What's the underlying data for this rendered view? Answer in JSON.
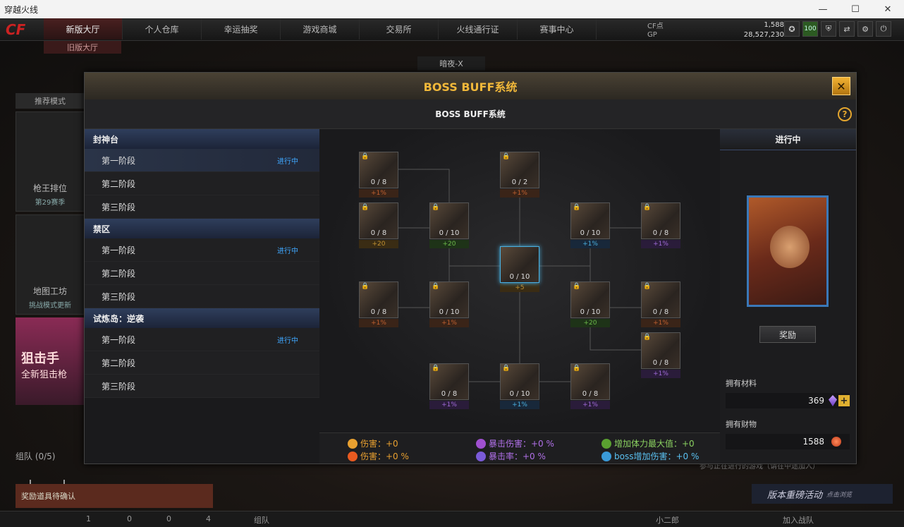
{
  "window": {
    "title": "穿越火线",
    "controls": [
      "—",
      "☐",
      "✕"
    ]
  },
  "topnav": {
    "logo": "CF",
    "tabs": [
      "新版大厅",
      "个人仓库",
      "幸运抽奖",
      "游戏商城",
      "交易所",
      "火线通行证",
      "赛事中心"
    ],
    "old_hall": "旧版大厅",
    "currency": [
      {
        "label": "CF点",
        "value": "1,588"
      },
      {
        "label": "GP",
        "value": "28,527,230"
      }
    ],
    "level_badge": "100"
  },
  "map_name": "暗夜-X",
  "bg_left": {
    "header": "推荐模式",
    "card1_title": "枪王排位",
    "card1_sub": "第29赛季",
    "card2_title": "地图工坊",
    "card2_sub": "挑战模式更新",
    "promo_line1": "狙击手",
    "promo_line2": "全新狙击枪",
    "team": "组队 (0/5)",
    "reward_confirm": "奖励道具待确认"
  },
  "bottombar": {
    "items": [
      "1",
      "0",
      "0",
      "4",
      "组队",
      "小二郎",
      "加入战队"
    ]
  },
  "bg_right": {
    "version_banner": "版本重磅活动",
    "version_sub": "点击浏览",
    "info_strip": "参与正在进行的游戏（请在中途加入）"
  },
  "modal": {
    "title": "BOSS BUFF系统",
    "subtitle": "BOSS BUFF系统",
    "close": "✕",
    "help": "?",
    "groups": [
      {
        "title": "封神台",
        "stages": [
          {
            "label": "第一阶段",
            "status": "进行中",
            "active": true
          },
          {
            "label": "第二阶段",
            "status": ""
          },
          {
            "label": "第三阶段",
            "status": ""
          }
        ]
      },
      {
        "title": "禁区",
        "stages": [
          {
            "label": "第一阶段",
            "status": "进行中"
          },
          {
            "label": "第二阶段",
            "status": ""
          },
          {
            "label": "第三阶段",
            "status": ""
          }
        ]
      },
      {
        "title": "试炼岛：逆袭",
        "stages": [
          {
            "label": "第一阶段",
            "status": "进行中"
          },
          {
            "label": "第二阶段",
            "status": ""
          },
          {
            "label": "第三阶段",
            "status": ""
          }
        ]
      }
    ],
    "nodes": [
      {
        "count": "0 / 8",
        "buff": "+1%",
        "kind": "red"
      },
      {
        "count": "0 / 2",
        "buff": "+1%",
        "kind": "red"
      },
      {
        "count": "0 / 8",
        "buff": "+20",
        "kind": "gold"
      },
      {
        "count": "0 / 10",
        "buff": "+20",
        "kind": "green"
      },
      {
        "count": "0 / 10",
        "buff": "+1%",
        "kind": "blue"
      },
      {
        "count": "0 / 8",
        "buff": "+1%",
        "kind": "purple"
      },
      {
        "count": "0 / 10",
        "buff": "+5",
        "kind": "gold"
      },
      {
        "count": "0 / 8",
        "buff": "+1%",
        "kind": "red"
      },
      {
        "count": "0 / 10",
        "buff": "+1%",
        "kind": "red"
      },
      {
        "count": "0 / 10",
        "buff": "+20",
        "kind": "green"
      },
      {
        "count": "0 / 8",
        "buff": "+1%",
        "kind": "red"
      },
      {
        "count": "0 / 8",
        "buff": "+1%",
        "kind": "purple"
      },
      {
        "count": "0 / 8",
        "buff": "+1%",
        "kind": "purple"
      },
      {
        "count": "0 / 10",
        "buff": "+1%",
        "kind": "blue"
      },
      {
        "count": "0 / 8",
        "buff": "+1%",
        "kind": "purple"
      }
    ],
    "legend": [
      {
        "label": "伤害：+0",
        "color": "#e8a030",
        "text": "#e8a030"
      },
      {
        "label": "伤害：+0 %",
        "color": "#e85a20",
        "text": "#e8a030"
      },
      {
        "label": "暴击伤害：+0 %",
        "color": "#a050d0",
        "text": "#b070e8"
      },
      {
        "label": "暴击率：+0 %",
        "color": "#7a5ad8",
        "text": "#b070e8"
      },
      {
        "label": "增加体力最大值：+0",
        "color": "#5aa030",
        "text": "#8ad060"
      },
      {
        "label": "boss增加伤害：+0 %",
        "color": "#3a9ad8",
        "text": "#5ac0f0"
      }
    ],
    "right": {
      "state": "进行中",
      "reward_button": "奖励",
      "materials_label": "拥有材料",
      "materials_value": "369",
      "wealth_label": "拥有财物",
      "wealth_value": "1588"
    }
  }
}
